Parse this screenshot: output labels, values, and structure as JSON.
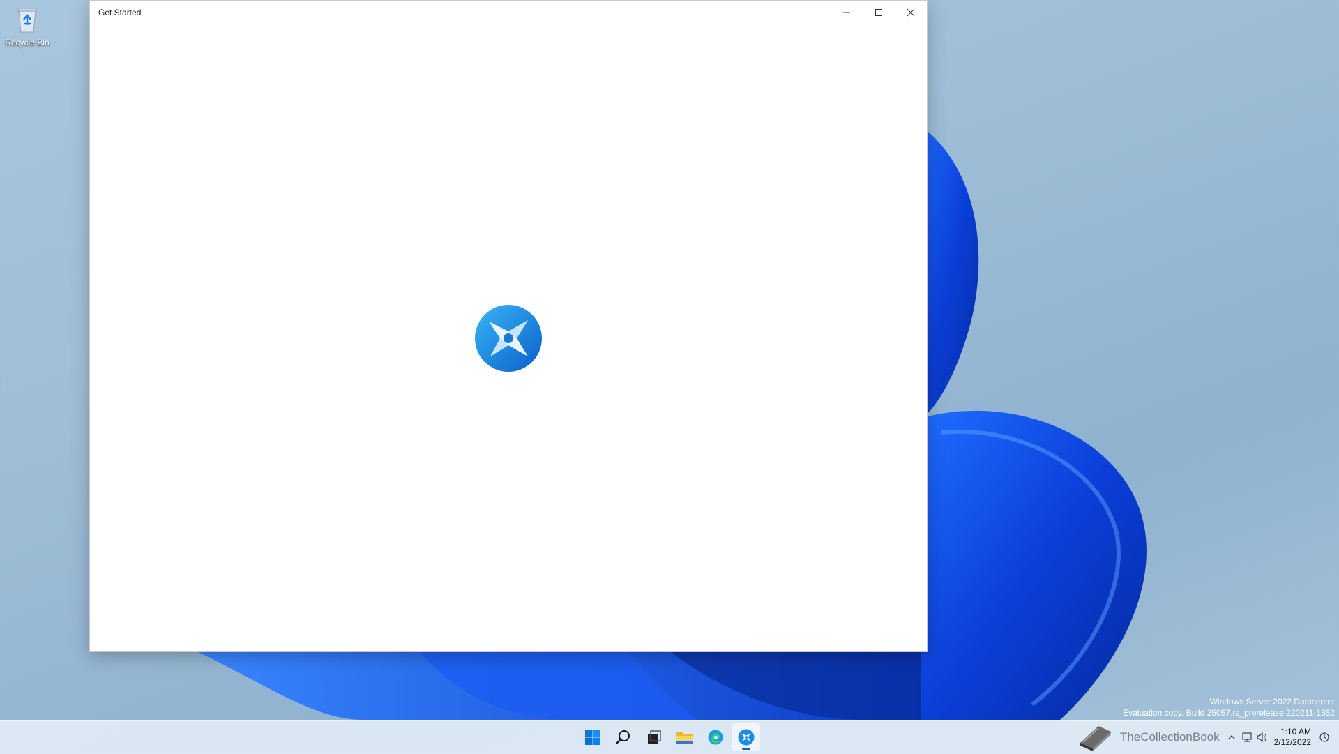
{
  "desktop": {
    "recycle_bin_label": "Recycle Bin"
  },
  "window": {
    "title": "Get Started",
    "controls": {
      "minimize": "minimize-icon",
      "maximize": "maximize-icon",
      "close": "close-icon"
    }
  },
  "watermark": {
    "line1": "Windows Server 2022 Datacenter",
    "line2": "Evaluation copy. Build 25057.rs_prerelease.220211-1352"
  },
  "taskbar": {
    "apps": [
      "start-icon",
      "search-icon",
      "task-view-icon",
      "file-explorer-icon",
      "edge-icon",
      "get-started-icon"
    ],
    "active_app": "get-started-icon",
    "tray_overlay_text": "TheCollectionBook",
    "clock": {
      "time": "1:10 AM",
      "date": "2/12/2022"
    }
  },
  "colors": {
    "accent": "#0067c0",
    "wallpaper_blue": "#0a4ee8"
  }
}
